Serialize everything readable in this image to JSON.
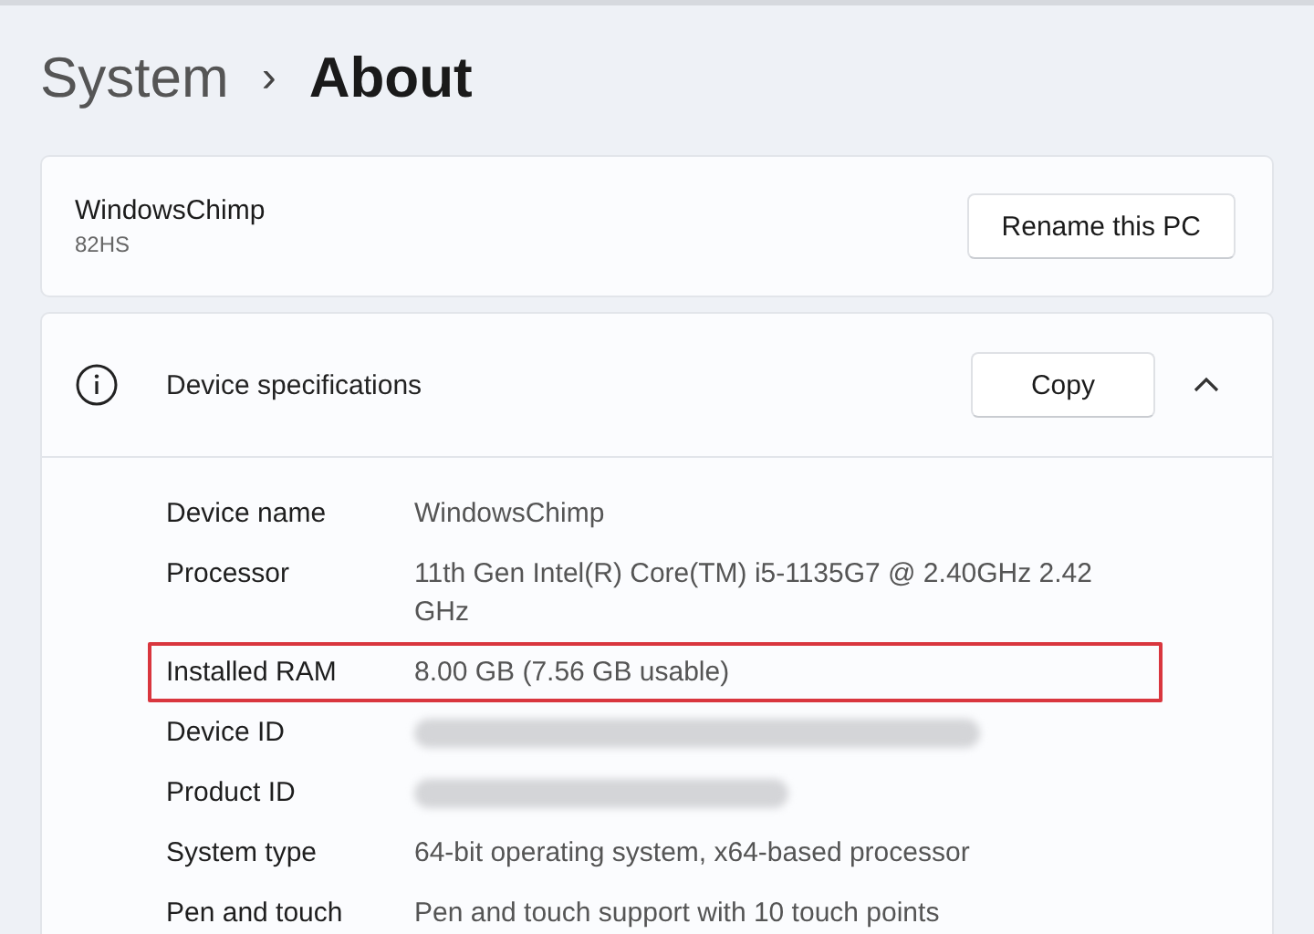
{
  "breadcrumb": {
    "parent": "System",
    "separator": "›",
    "current": "About"
  },
  "pc": {
    "name": "WindowsChimp",
    "model": "82HS",
    "button": "Rename this PC"
  },
  "specs": {
    "title": "Device specifications",
    "button": "Copy",
    "expanded": true,
    "rows": [
      {
        "label": "Device name",
        "value": "WindowsChimp",
        "highlighted": false,
        "kind": "text"
      },
      {
        "label": "Processor",
        "value": "11th Gen Intel(R) Core(TM) i5-1135G7 @ 2.40GHz   2.42 GHz",
        "highlighted": false,
        "kind": "text"
      },
      {
        "label": "Installed RAM",
        "value": "8.00 GB (7.56 GB usable)",
        "highlighted": true,
        "kind": "text"
      },
      {
        "label": "Device ID",
        "highlighted": false,
        "kind": "redacted"
      },
      {
        "label": "Product ID",
        "highlighted": false,
        "kind": "redacted"
      },
      {
        "label": "System type",
        "value": "64-bit operating system, x64-based processor",
        "highlighted": false,
        "kind": "text"
      },
      {
        "label": "Pen and touch",
        "value": "Pen and touch support with 10 touch points",
        "highlighted": false,
        "kind": "text"
      }
    ]
  }
}
